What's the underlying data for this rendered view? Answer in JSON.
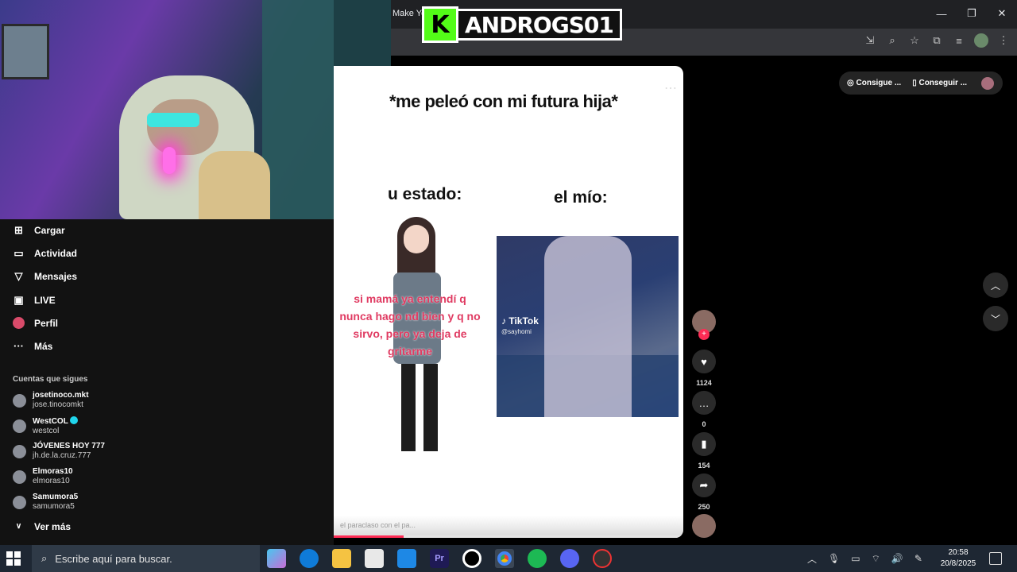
{
  "browser": {
    "tab_title": "Make Yo",
    "controls": {
      "minimize": "—",
      "maximize": "❐",
      "close": "✕"
    }
  },
  "brand": {
    "k_letter": "K",
    "name": "ANDROGS01"
  },
  "sidebar": {
    "items": [
      {
        "label": "Cargar",
        "icon": "plus-square-icon"
      },
      {
        "label": "Actividad",
        "icon": "activity-icon"
      },
      {
        "label": "Mensajes",
        "icon": "send-icon"
      },
      {
        "label": "LIVE",
        "icon": "live-tv-icon"
      },
      {
        "label": "Perfil",
        "icon": "profile-icon"
      },
      {
        "label": "Más",
        "icon": "more-dots-icon"
      }
    ],
    "following_title": "Cuentas que sigues",
    "accounts": [
      {
        "name": "josetinoco.mkt",
        "handle": "jose.tinocomkt",
        "verified": false
      },
      {
        "name": "WestCOL",
        "handle": "westcol",
        "verified": true
      },
      {
        "name": "JÓVENES HOY 777",
        "handle": "jh.de.la.cruz.777",
        "verified": false
      },
      {
        "name": "Elmoras10",
        "handle": "elmoras10",
        "verified": false
      },
      {
        "name": "Samumora5",
        "handle": "samumora5",
        "verified": false
      }
    ],
    "see_more": "Ver más"
  },
  "video": {
    "caption_top": "*me peleó con mi futura hija*",
    "caption_left": "u estado:",
    "caption_right": "el mío:",
    "pink_text": "si mamá ya entendí q nunca hago nd bien y q no sirvo, pero ya deja de gritarme",
    "tiktok_label": "TikTok",
    "tiktok_handle": "@sayhomi",
    "footer_text": "el paraclaso con el pa...",
    "progress": 0.2
  },
  "actions": {
    "likes": "1124",
    "comments": "0",
    "saves": "154",
    "shares": "250"
  },
  "top_pills": {
    "left": "Consigue ...",
    "right": "Conseguir ..."
  },
  "taskbar": {
    "search_placeholder": "Escribe aquí para buscar.",
    "time": "20:58",
    "date": "20/8/2025",
    "apps": [
      "copilot-icon",
      "edge-icon",
      "file-explorer-icon",
      "store-icon",
      "mail-icon",
      "premiere-icon",
      "obs-record-icon",
      "chrome-icon",
      "spotify-icon",
      "discord-icon",
      "app-icon"
    ]
  },
  "colors": {
    "accent": "#fe2c55",
    "kick_green": "#53fc18"
  }
}
